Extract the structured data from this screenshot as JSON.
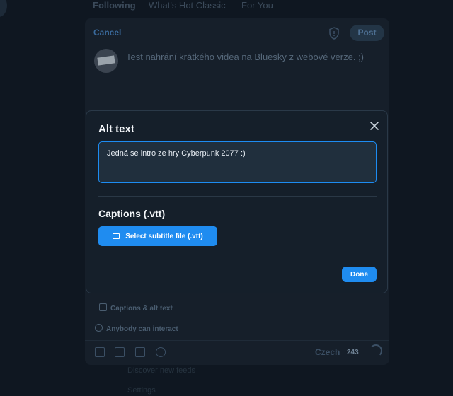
{
  "feed": {
    "tabs": [
      "Following",
      "What's Hot Classic",
      "For You"
    ],
    "below_items": [
      "Discover new feeds",
      "Settings"
    ]
  },
  "composer": {
    "cancel_label": "Cancel",
    "post_label": "Post",
    "draft_text": "Test nahrání krátkého videa na Bluesky z webové verze. ;)",
    "captions_alt_label": "Captions & alt text",
    "interaction_label": "Anybody can interact",
    "language": "Czech",
    "char_count": "243"
  },
  "modal": {
    "title": "Alt text",
    "alt_text_value": "Jedná se intro ze hry Cyberpunk 2077 :)",
    "captions_title": "Captions (.vtt)",
    "select_file_label": "Select subtitle file (.vtt)",
    "done_label": "Done"
  },
  "colors": {
    "accent": "#1f8cf0",
    "background": "#0f1721",
    "surface": "#151f2a"
  }
}
